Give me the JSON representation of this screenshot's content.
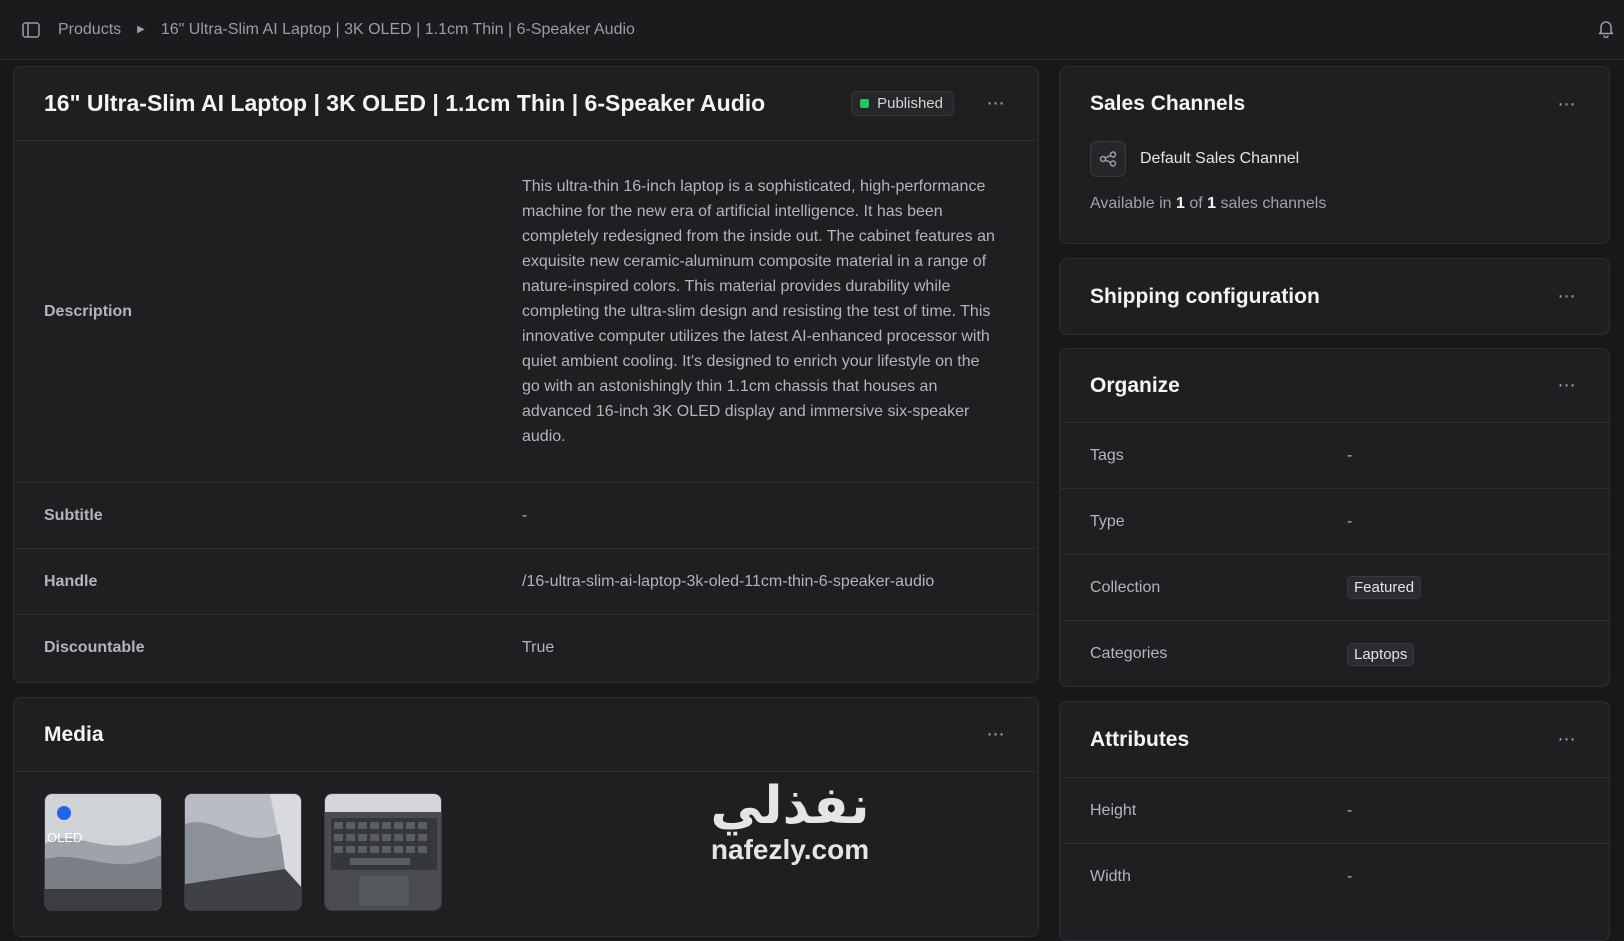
{
  "breadcrumb": {
    "root": "Products",
    "current": "16\" Ultra-Slim AI Laptop | 3K OLED | 1.1cm Thin | 6-Speaker Audio"
  },
  "product": {
    "title": "16\" Ultra-Slim AI Laptop | 3K OLED | 1.1cm Thin | 6-Speaker Audio",
    "status": "Published",
    "status_color": "#22c55e",
    "fields": {
      "description_label": "Description",
      "description_value": "This ultra-thin 16-inch laptop is a sophisticated, high-performance machine for the new era of artificial intelligence. It has been completely redesigned from the inside out. The cabinet features an exquisite new ceramic-aluminum composite material in a range of nature-inspired colors. This material provides durability while completing the ultra-slim design and resisting the test of time. This innovative computer utilizes the latest AI-enhanced processor with quiet ambient cooling. It's designed to enrich your lifestyle on the go with an astonishingly thin 1.1cm chassis that houses an advanced 16-inch 3K OLED display and immersive six-speaker audio.",
      "subtitle_label": "Subtitle",
      "subtitle_value": "-",
      "handle_label": "Handle",
      "handle_value": "/16-ultra-slim-ai-laptop-3k-oled-11cm-thin-6-speaker-audio",
      "discountable_label": "Discountable",
      "discountable_value": "True"
    }
  },
  "media": {
    "title": "Media",
    "thumb1_text": "OLED"
  },
  "sales_channels": {
    "title": "Sales Channels",
    "channel_name": "Default Sales Channel",
    "avail_prefix": "Available in",
    "avail_count": "1",
    "avail_of": "of",
    "avail_total": "1",
    "avail_suffix": "sales channels"
  },
  "shipping": {
    "title": "Shipping configuration"
  },
  "organize": {
    "title": "Organize",
    "tags_label": "Tags",
    "tags_value": "-",
    "type_label": "Type",
    "type_value": "-",
    "collection_label": "Collection",
    "collection_value": "Featured",
    "categories_label": "Categories",
    "categories_value": "Laptops"
  },
  "attributes": {
    "title": "Attributes",
    "height_label": "Height",
    "height_value": "-",
    "width_label": "Width",
    "width_value": "-"
  },
  "watermark": {
    "arabic": "نفذلي",
    "latin": "nafezly.com"
  }
}
